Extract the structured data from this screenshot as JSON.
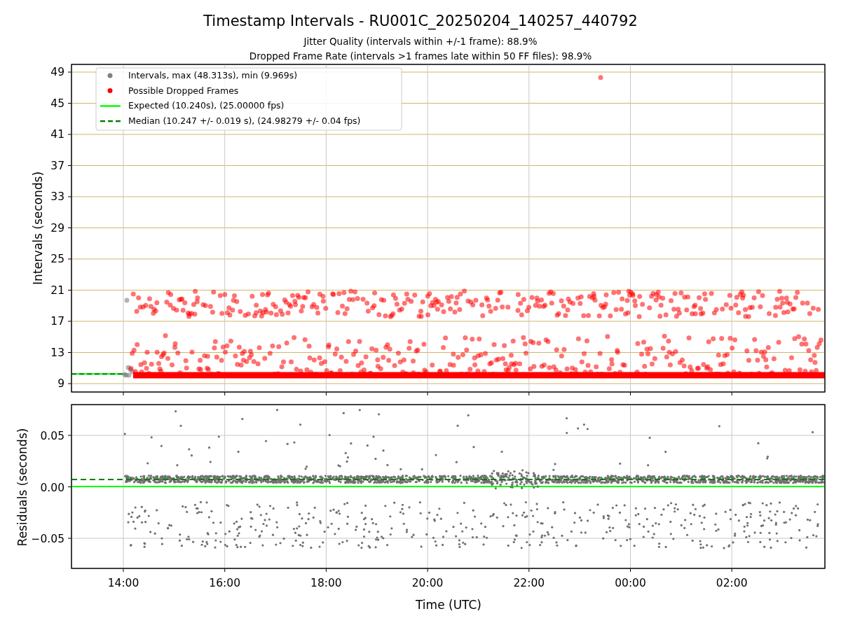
{
  "figure": {
    "title": "Timestamp Intervals - RU001C_20250204_140257_440792",
    "subtitles": [
      "Jitter Quality (intervals within +/-1 frame): 88.9%",
      "Dropped Frame Rate (intervals >1 frames late within 50 FF files): 98.9%"
    ]
  },
  "top_plot": {
    "ylabel": "Intervals (seconds)",
    "yticks": [
      "49",
      "45",
      "41",
      "37",
      "33",
      "29",
      "25",
      "21",
      "17",
      "13",
      "9"
    ],
    "legend": [
      {
        "kind": "dot",
        "color": "#808080",
        "label": "Intervals, max (48.313s), min (9.969s)"
      },
      {
        "kind": "dot",
        "color": "#ff0000",
        "label": "Possible Dropped Frames"
      },
      {
        "kind": "solid",
        "color": "#00ff00",
        "label": "Expected (10.240s), (25.00000 fps)"
      },
      {
        "kind": "dashed",
        "color": "#008000",
        "label": "Median (10.247 +/- 0.019 s), (24.98279 +/- 0.04 fps)"
      }
    ]
  },
  "bottom_plot": {
    "ylabel": "Residuals (seconds)",
    "yticks": [
      "0.05",
      "0.00",
      "−0.05"
    ],
    "xlabel": "Time (UTC)",
    "xticks": [
      "14:00",
      "16:00",
      "18:00",
      "20:00",
      "22:00",
      "00:00",
      "02:00"
    ]
  }
}
